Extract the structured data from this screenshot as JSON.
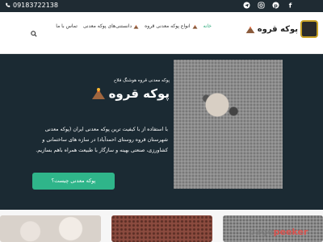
{
  "topbar": {
    "phone": "09183722138",
    "socials": [
      "telegram-icon",
      "instagram-icon",
      "pinterest-icon",
      "facebook-icon"
    ]
  },
  "header": {
    "logo_text": "پوکه قروه",
    "nav": [
      {
        "label": "خانه",
        "active": true
      },
      {
        "label": "انواع پوکه معدنی قروه",
        "active": false
      },
      {
        "label": "دانستنی‌های پوکه معدنی",
        "active": false
      },
      {
        "label": "تماس با ما",
        "active": false
      }
    ]
  },
  "hero": {
    "subtitle": "پوکه معدنی قروه هوشنگ فلاح",
    "title": "پوکه قروه",
    "description": "با استفاده از با کیفیت ترین پوکه معدنی ایران (پوکه معدنی شهرستان قروه روستای احمدآباد) در سازه های ساختمانی و کشاورزی، صنعتی بهینه و سازگار با طبیعت همراه باهم بسازیم.",
    "button_label": "پوکه معدنی چیست؟"
  },
  "watermark": {
    "part1": "page",
    "part2": "peeker"
  },
  "colors": {
    "accent": "#2fb58a",
    "dark": "#1b2a33"
  }
}
